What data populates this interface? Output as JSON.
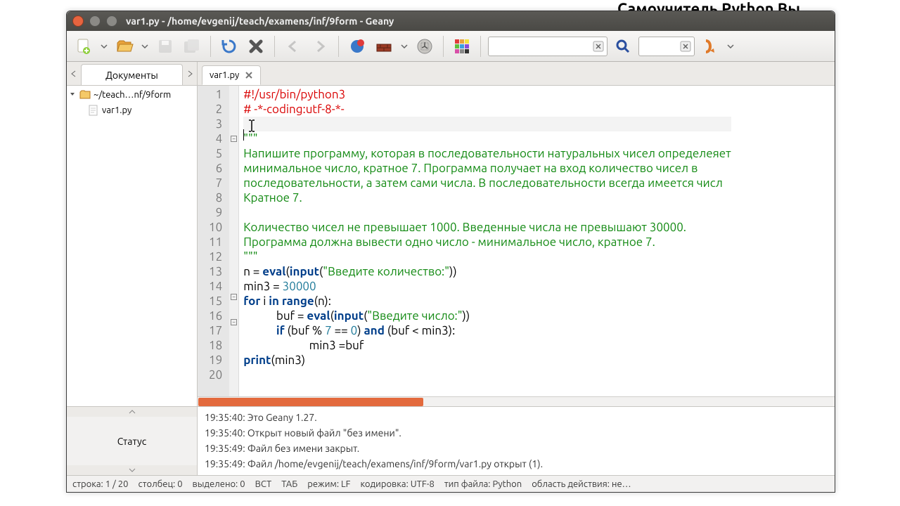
{
  "background": {
    "top_text": "Самоучитель Python  Вы"
  },
  "window": {
    "title": "var1.py - /home/evgenij/teach/examens/inf/9form - Geany",
    "buttons": {
      "close": "#e7643f",
      "min": "#8b8a86",
      "max": "#8b8a86"
    }
  },
  "toolbar": {
    "icons": [
      "new-file",
      "new-drop",
      "open-file",
      "open-drop",
      "save",
      "save-all",
      "sep",
      "reload",
      "close",
      "sep",
      "nav-back",
      "nav-fwd",
      "sep",
      "compile",
      "build",
      "build-drop",
      "run",
      "sep",
      "color-picker",
      "sep"
    ],
    "search_value": "",
    "goto_value": ""
  },
  "sidebar": {
    "tab_label": "Документы",
    "tree": {
      "folder": "~/teach…nf/9form",
      "file": "var1.py"
    }
  },
  "editor": {
    "tab": "var1.py",
    "lines": [
      {
        "n": 1,
        "seg": [
          {
            "c": "c-cmt",
            "t": "#!/usr/bin/python3"
          }
        ]
      },
      {
        "n": 2,
        "seg": [
          {
            "c": "c-cmt",
            "t": "# -*-coding:utf-8-*-"
          }
        ]
      },
      {
        "n": 3,
        "seg": [],
        "current": true
      },
      {
        "n": 4,
        "seg": [
          {
            "c": "c-str",
            "t": "\"\"\""
          }
        ],
        "fold": "-"
      },
      {
        "n": 5,
        "seg": [
          {
            "c": "c-str",
            "t": "Напишите программу, которая в последовательности натуральных чисел определеяет"
          }
        ]
      },
      {
        "n": 6,
        "seg": [
          {
            "c": "c-str",
            "t": "минимальное число, кратное 7. Программа получает на вход количество чисел в"
          }
        ]
      },
      {
        "n": 7,
        "seg": [
          {
            "c": "c-str",
            "t": "последовательности, а затем сами числа. В последовательности всегда имеется числ"
          }
        ]
      },
      {
        "n": 8,
        "seg": [
          {
            "c": "c-str",
            "t": "Кратное 7."
          }
        ]
      },
      {
        "n": 9,
        "seg": []
      },
      {
        "n": 10,
        "seg": [
          {
            "c": "c-str",
            "t": "Количество чисел не превышает 1000. Введенные числа не превышают 30000."
          }
        ]
      },
      {
        "n": 11,
        "seg": [
          {
            "c": "c-str",
            "t": "Программа должна вывести одно число - минимальное число, кратное 7."
          }
        ]
      },
      {
        "n": 12,
        "seg": [
          {
            "c": "c-str",
            "t": "\"\"\""
          }
        ]
      },
      {
        "n": 13,
        "seg": [
          {
            "c": "",
            "t": "n = "
          },
          {
            "c": "c-kw",
            "t": "eval"
          },
          {
            "c": "",
            "t": "("
          },
          {
            "c": "c-kw",
            "t": "input"
          },
          {
            "c": "",
            "t": "("
          },
          {
            "c": "c-str",
            "t": "\"Введите количество:\""
          },
          {
            "c": "",
            "t": "))"
          }
        ]
      },
      {
        "n": 14,
        "seg": [
          {
            "c": "",
            "t": "min3 = "
          },
          {
            "c": "c-num",
            "t": "30000"
          }
        ]
      },
      {
        "n": 15,
        "seg": [
          {
            "c": "c-kw",
            "t": "for"
          },
          {
            "c": "",
            "t": " i "
          },
          {
            "c": "c-kw",
            "t": "in"
          },
          {
            "c": "",
            "t": " "
          },
          {
            "c": "c-kw",
            "t": "range"
          },
          {
            "c": "",
            "t": "(n):"
          }
        ],
        "fold": "-"
      },
      {
        "n": 16,
        "seg": [
          {
            "c": "",
            "t": "            buf = "
          },
          {
            "c": "c-kw",
            "t": "eval"
          },
          {
            "c": "",
            "t": "("
          },
          {
            "c": "c-kw",
            "t": "input"
          },
          {
            "c": "",
            "t": "("
          },
          {
            "c": "c-str",
            "t": "\"Введите число:\""
          },
          {
            "c": "",
            "t": "))"
          }
        ]
      },
      {
        "n": 17,
        "seg": [
          {
            "c": "",
            "t": "            "
          },
          {
            "c": "c-kw",
            "t": "if"
          },
          {
            "c": "",
            "t": " (buf % "
          },
          {
            "c": "c-num",
            "t": "7"
          },
          {
            "c": "",
            "t": " == "
          },
          {
            "c": "c-num",
            "t": "0"
          },
          {
            "c": "",
            "t": ") "
          },
          {
            "c": "c-kw",
            "t": "and"
          },
          {
            "c": "",
            "t": " (buf < min3):"
          }
        ],
        "fold": "-"
      },
      {
        "n": 18,
        "seg": [
          {
            "c": "",
            "t": "                        min3 =buf"
          }
        ]
      },
      {
        "n": 19,
        "seg": [
          {
            "c": "c-kw",
            "t": "print"
          },
          {
            "c": "",
            "t": "(min3)"
          }
        ]
      },
      {
        "n": 20,
        "seg": []
      }
    ]
  },
  "messages": {
    "panel_label": "Статус",
    "items": [
      "19:35:40: Это Geany 1.27.",
      "19:35:40: Открыт новый файл \"без имени\".",
      "19:35:49: Файл без имени закрыт.",
      "19:35:49: Файл /home/evgenij/teach/examens/inf/9form/var1.py открыт (1)."
    ]
  },
  "statusbar": {
    "line": "строка: 1 / 20",
    "col": "столбец: 0",
    "sel": "выделено: 0",
    "ins": "ВСТ",
    "tab": "ТАБ",
    "lf": "режим: LF",
    "enc": "кодировка: UTF-8",
    "ftype": "тип файла: Python",
    "scope": "область действия: не…"
  }
}
